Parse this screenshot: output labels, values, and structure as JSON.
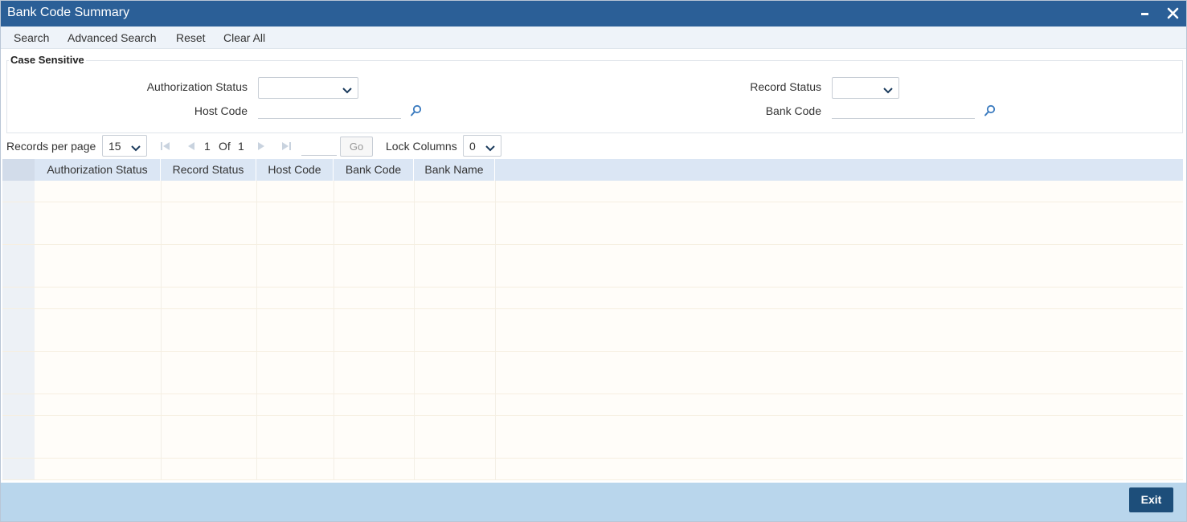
{
  "window": {
    "title": "Bank Code Summary"
  },
  "toolbar": {
    "search": "Search",
    "advanced_search": "Advanced Search",
    "reset": "Reset",
    "clear_all": "Clear All"
  },
  "criteria": {
    "legend": "Case Sensitive",
    "authorization_status_label": "Authorization Status",
    "authorization_status_value": "",
    "record_status_label": "Record Status",
    "record_status_value": "",
    "host_code_label": "Host Code",
    "host_code_value": "",
    "bank_code_label": "Bank Code",
    "bank_code_value": ""
  },
  "pager": {
    "records_per_page_label": "Records per page",
    "records_per_page_value": "15",
    "current_page": "1",
    "of_label": "Of",
    "total_pages": "1",
    "go_label": "Go",
    "lock_columns_label": "Lock Columns",
    "lock_columns_value": "0"
  },
  "grid": {
    "columns": [
      "Authorization Status",
      "Record Status",
      "Host Code",
      "Bank Code",
      "Bank Name"
    ],
    "row_count": 14
  },
  "footer": {
    "exit_label": "Exit"
  },
  "icons": {
    "minimize": "minimize-icon",
    "close": "close-icon",
    "lookup": "search-icon",
    "dropdown": "chevron-down-icon",
    "first": "first-page-icon",
    "prev": "prev-page-icon",
    "next": "next-page-icon",
    "last": "last-page-icon"
  },
  "colors": {
    "titlebar": "#2b5f97",
    "header_row": "#dbe6f4",
    "footer": "#b9d6ec",
    "exit_button": "#1d4e7a"
  }
}
